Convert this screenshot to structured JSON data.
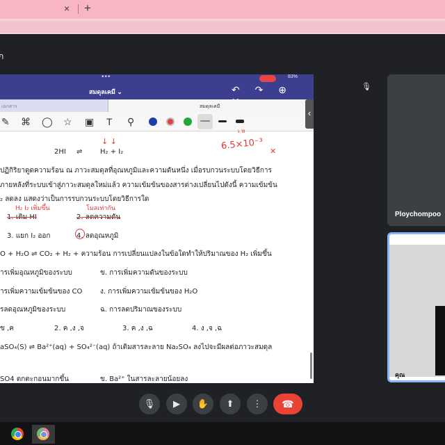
{
  "browser": {
    "close_glyph": "×",
    "newtab_glyph": "+"
  },
  "meet": {
    "title_fragment": "ก"
  },
  "ipad": {
    "dots": "•••",
    "battery": "83%",
    "doc_title": "สมดุลเคมี ⌄",
    "nav_icons": "↶ ↷ ⊕ ✕ ⋯",
    "left_tab_label": "เอกสาร",
    "right_tab_label": "สมดุลเคมี",
    "side_handle": "‹",
    "colors": [
      "#1a3faa",
      "#e34040",
      "#22a83a"
    ]
  },
  "document": {
    "eq_left": "2HI",
    "eq_arrow": "⇌",
    "eq_right": "H₂ + I₂",
    "para1": "ปฏิกิริยาดูดความร้อน ณ ภาวะสมดุลที่อุณหภูมิและความดันหนึ่ง เมื่อรบกวนระบบโดยวิธีการ",
    "para2": "ภายหลังที่ระบบเข้าสู่ภาวะสมดุลใหม่แล้ว ความเข้มข้นของสารต่างเปลี่ยนไปดังนี้ ความเข้มข้น",
    "para3": "₂ ลดลง แสดงว่าเป็นการรบกวนระบบโดยวิธีการใด",
    "opt1": "1. เติม HI",
    "opt2": "2. ลดความดัน",
    "opt3": "3. แยก I₂ ออก",
    "opt4": "4. ลดอุณหภูมิ",
    "q2": "O + H₂O ⇌ CO₂ + H₂ + ความร้อน การเปลี่ยนแปลงในข้อใดทำให้ปริมาณของ H₂ เพิ่มขึ้น",
    "q2a": "ารเพิ่มอุณหภูมิของระบบ",
    "q2b": "ข. การเพิ่มความดันของระบบ",
    "q2c": "ารเพิ่มความเข้มข้นของ CO",
    "q2d": "ง. การเพิ่มความเข้มข้นของ H₂O",
    "q2e": "รลดอุณหภูมิของระบบ",
    "q2f": "ฉ. การลดปริมาณของระบบ",
    "ans1": "ข ,ค",
    "ans2": "2. ค ,ง ,จ",
    "ans3": "3. ค ,ง ,ฉ",
    "ans4": "4. ง ,จ ,ฉ",
    "q3": "aSO₄(S)  ⇌  Ba²⁺(aq) + SO₄²⁻(aq) ถ้าเติมสารละลาย  Na₂SO₄ ลงไปจะมีผลต่อภาวะสมดุล",
    "q3a": "SO4 ตกตะกอนมากขึ้น",
    "q3b": "ข. Ba²⁺ ในสารละลายน้อยลง"
  },
  "annotations": {
    "top_right": "6.5×10⁻³",
    "top_frag": "เ ห",
    "h2i2": "H₂  I₂  เพิ่มขึ้น",
    "mole": "โมลเท่ากัน",
    "arrows": "↓  ↓"
  },
  "participants": [
    {
      "name": "Ploychompoo"
    },
    {
      "name": "คุณ"
    }
  ],
  "controls": {
    "mic": "🎙",
    "camera": "▶",
    "hand": "✋",
    "present": "⬆",
    "more": "⋮",
    "end": "☎",
    "mic_off": "🎙"
  }
}
